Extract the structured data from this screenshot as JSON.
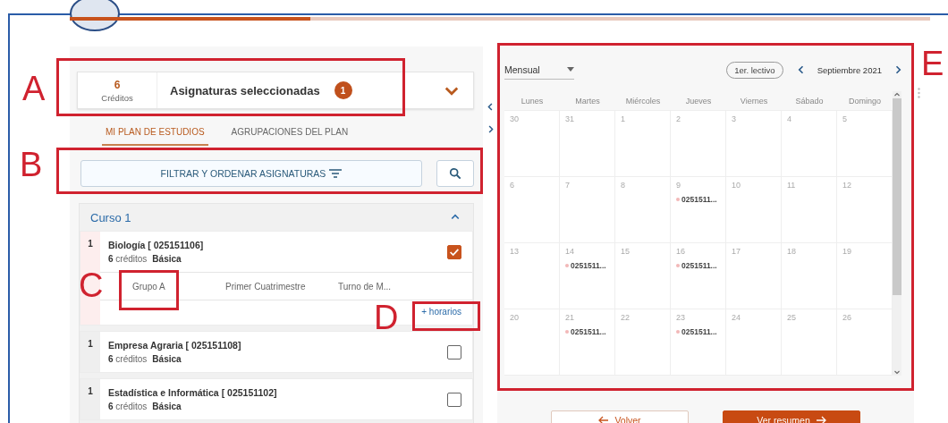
{
  "progress": {
    "level": 0.28
  },
  "summary": {
    "credits": "6",
    "credits_label": "Créditos",
    "title": "Asignaturas seleccionadas",
    "count": "1",
    "expanded": false
  },
  "tabs": [
    {
      "label": "MI PLAN DE ESTUDIOS",
      "selected": true
    },
    {
      "label": "AGRUPACIONES DEL PLAN",
      "selected": false
    }
  ],
  "filter_button": "FILTRAR Y ORDENAR ASIGNATURAS",
  "course": {
    "title": "Curso 1",
    "expanded": true,
    "subjects": [
      {
        "number": "1",
        "name": "Biología [ 025151106]",
        "credits": "6",
        "credits_label": "créditos",
        "type": "Básica",
        "checked": true,
        "groups": [
          "Grupo A",
          "Primer Cuatrimestre",
          "Turno de M..."
        ],
        "more_link": "+ horarios"
      },
      {
        "number": "1",
        "name": "Empresa Agraria [ 025151108]",
        "credits": "6",
        "credits_label": "créditos",
        "type": "Básica",
        "checked": false
      },
      {
        "number": "1",
        "name": "Estadística e Informática [ 025151102]",
        "credits": "6",
        "credits_label": "créditos",
        "type": "Básica",
        "checked": false
      }
    ]
  },
  "calendar": {
    "view": "Mensual",
    "today_button": "1er. lectivo",
    "month": "Septiembre 2021",
    "weekdays": [
      "Lunes",
      "Martes",
      "Miércoles",
      "Jueves",
      "Viernes",
      "Sábado",
      "Domingo"
    ],
    "weeks": [
      {
        "days": [
          {
            "day": "30"
          },
          {
            "day": "31"
          },
          {
            "day": "1"
          },
          {
            "day": "2"
          },
          {
            "day": "3"
          },
          {
            "day": "4"
          },
          {
            "day": "5"
          }
        ]
      },
      {
        "days": [
          {
            "day": "6"
          },
          {
            "day": "7"
          },
          {
            "day": "8"
          },
          {
            "day": "9",
            "events": [
              {
                "label": "0251511...",
                "color": "#f2b8b8"
              }
            ]
          },
          {
            "day": "10"
          },
          {
            "day": "11"
          },
          {
            "day": "12"
          }
        ]
      },
      {
        "days": [
          {
            "day": "13"
          },
          {
            "day": "14",
            "events": [
              {
                "label": "0251511...",
                "color": "#f2b8b8"
              }
            ]
          },
          {
            "day": "15"
          },
          {
            "day": "16",
            "events": [
              {
                "label": "0251511...",
                "color": "#f2b8b8"
              }
            ]
          },
          {
            "day": "17"
          },
          {
            "day": "18"
          },
          {
            "day": "19"
          }
        ]
      },
      {
        "days": [
          {
            "day": "20"
          },
          {
            "day": "21",
            "events": [
              {
                "label": "0251511...",
                "color": "#f2b8b8"
              }
            ]
          },
          {
            "day": "22"
          },
          {
            "day": "23",
            "events": [
              {
                "label": "0251511...",
                "color": "#f2b8b8"
              }
            ]
          },
          {
            "day": "24"
          },
          {
            "day": "25"
          },
          {
            "day": "26"
          }
        ]
      }
    ]
  },
  "footer_buttons": [
    {
      "label": "Volver",
      "kind": "back"
    },
    {
      "label": "Ver resumen",
      "kind": "next"
    }
  ],
  "annotations": [
    {
      "letter": "A"
    },
    {
      "letter": "B"
    },
    {
      "letter": "C"
    },
    {
      "letter": "D"
    },
    {
      "letter": "E"
    }
  ]
}
